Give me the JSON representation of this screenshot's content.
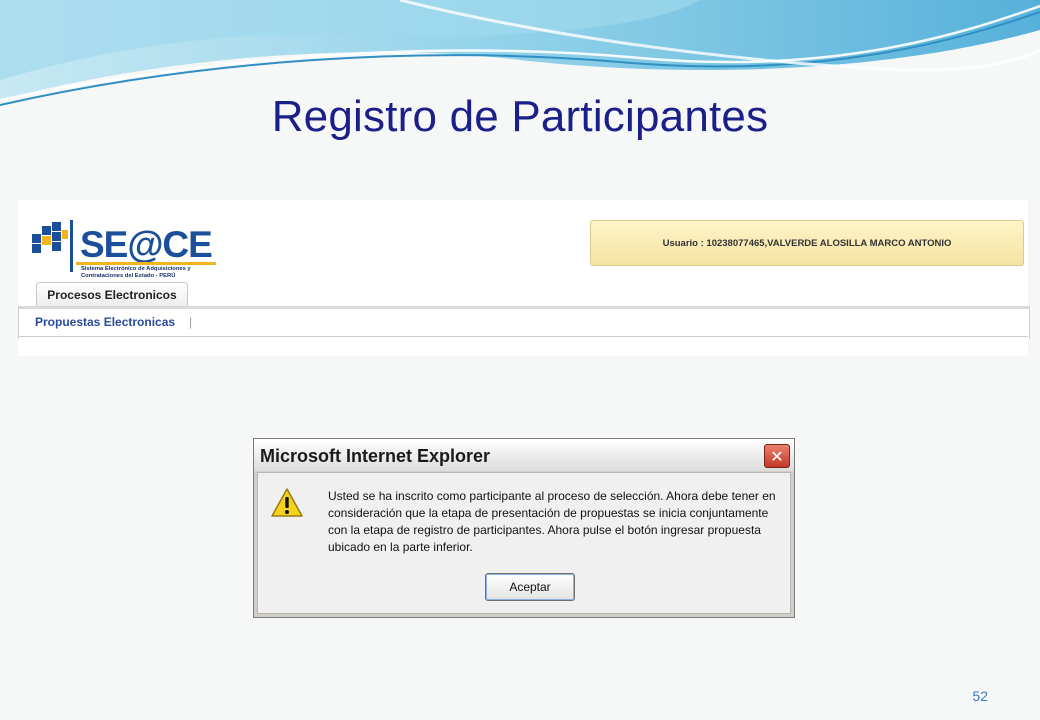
{
  "slide": {
    "title": "Registro de Participantes",
    "page_number": "52"
  },
  "seace": {
    "logo_text": "SE@CE",
    "logo_subtitle": "Sistema Electrónico de Adquisiciones y Contrataciones del Estado - PERÚ",
    "user_label": "Usuario : 10238077465,VALVERDE ALOSILLA MARCO ANTONIO",
    "tab_label": "Procesos Electronicos",
    "subnav_item": "Propuestas Electronicas",
    "subnav_separator": "|"
  },
  "dialog": {
    "title": "Microsoft Internet Explorer",
    "close_glyph": "✕",
    "message": "Usted se ha inscrito como participante al proceso de selección. Ahora debe tener en consideración que la etapa de presentación de propuestas se inicia conjuntamente con la etapa de registro de participantes. Ahora pulse el botón ingresar propuesta ubicado en la parte inferior.",
    "ok_label": "Aceptar"
  },
  "colors": {
    "title_blue": "#1b1f8a",
    "logo_blue": "#1b4f9a",
    "wave_blue": "#4aaed9",
    "dialog_gray": "#d4d0c8"
  }
}
